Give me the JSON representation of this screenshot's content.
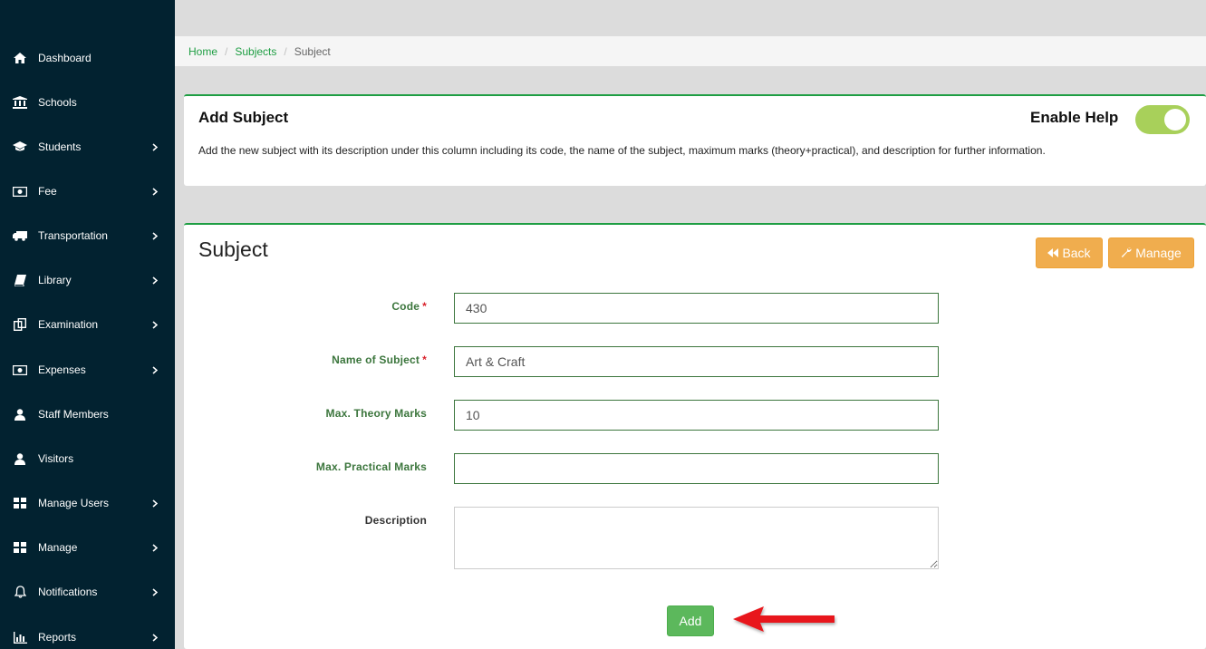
{
  "sidebar": {
    "items": [
      {
        "label": "Dashboard",
        "icon": "home-icon",
        "has_submenu": false
      },
      {
        "label": "Schools",
        "icon": "bank-icon",
        "has_submenu": false
      },
      {
        "label": "Students",
        "icon": "graduation-cap-icon",
        "has_submenu": true
      },
      {
        "label": "Fee",
        "icon": "money-icon",
        "has_submenu": true
      },
      {
        "label": "Transportation",
        "icon": "truck-icon",
        "has_submenu": true
      },
      {
        "label": "Library",
        "icon": "book-icon",
        "has_submenu": true
      },
      {
        "label": "Examination",
        "icon": "copy-icon",
        "has_submenu": true
      },
      {
        "label": "Expenses",
        "icon": "money-icon",
        "has_submenu": true
      },
      {
        "label": "Staff Members",
        "icon": "user-icon",
        "has_submenu": false
      },
      {
        "label": "Visitors",
        "icon": "user-icon",
        "has_submenu": false
      },
      {
        "label": "Manage Users",
        "icon": "grid-icon",
        "has_submenu": true
      },
      {
        "label": "Manage",
        "icon": "grid-icon",
        "has_submenu": true
      },
      {
        "label": "Notifications",
        "icon": "bell-icon",
        "has_submenu": true
      },
      {
        "label": "Reports",
        "icon": "bar-chart-icon",
        "has_submenu": true
      }
    ]
  },
  "breadcrumb": {
    "home": "Home",
    "subjects": "Subjects",
    "current": "Subject",
    "separator": "/"
  },
  "help": {
    "title": "Add Subject",
    "toggle_label": "Enable Help",
    "toggle_on": true,
    "text": "Add the new subject with its description under this column including its code, the name of the subject, maximum marks (theory+practical), and description for further information."
  },
  "form": {
    "title": "Subject",
    "back_label": "Back",
    "manage_label": "Manage",
    "code_label": "Code",
    "code_value": "430",
    "name_label": "Name of Subject",
    "name_value": "Art & Craft",
    "theory_label": "Max. Theory Marks",
    "theory_value": "10",
    "practical_label": "Max. Practical Marks",
    "practical_value": "",
    "description_label": "Description",
    "description_value": "",
    "required_mark": "*",
    "add_label": "Add"
  },
  "colors": {
    "sidebar_bg": "#022230",
    "accent_green": "#1e9e43",
    "label_green": "#3c763d",
    "warning": "#f0ad4e",
    "success": "#5cb85c",
    "toggle": "#a8d05a",
    "annotation_arrow": "#e8141a"
  }
}
